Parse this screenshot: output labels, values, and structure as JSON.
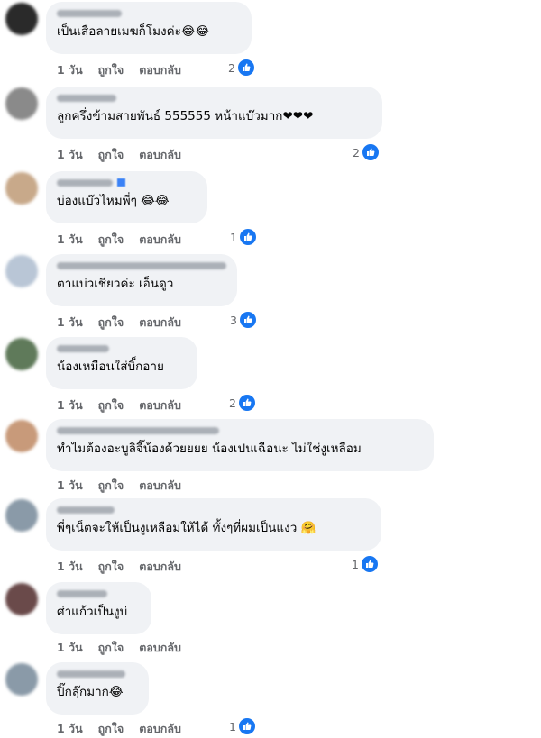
{
  "actions": {
    "time": "1 วัน",
    "like": "ถูกใจ",
    "reply": "ตอบกลับ"
  },
  "comments": [
    {
      "text": "เป็นเสือลายเมฆก็โมงค่ะ😂😂",
      "reactions": "2",
      "avatar_color": "#2a2a2a"
    },
    {
      "text": "ลูกครึ่งข้ามสายพันธ์ 555555 หน้าแบ๊วมาก❤❤❤",
      "reactions": "2",
      "avatar_color": "#8a8a8a"
    },
    {
      "text": "บ่องแบ๊วไหมพี่ๆ 😂😂",
      "reactions": "1",
      "avatar_color": "#c8a98a"
    },
    {
      "text": "ตาแบ่วเชียวค่ะ เอ็นดูว",
      "reactions": "3",
      "avatar_color": "#b9c6d6"
    },
    {
      "text": "น้องเหมือนใส่บิ็กอาย",
      "reactions": "2",
      "avatar_color": "#5f7a5a"
    },
    {
      "text": "ทำไมต้องอะบูลิจี๊น้องด้วยยยย น้องเปนเฉือนะ ไม่ใช่งูเหลือม",
      "reactions": "",
      "avatar_color": "#c89a7a"
    },
    {
      "text": "พี่ๆเน็ตจะให้เป็นงูเหลือมให้ได้ ทั้งๆที่ผมเป็นแงว 🤗",
      "reactions": "1",
      "avatar_color": "#8a9aa8"
    },
    {
      "text": "ศ่าแก้วเป็นงูบ่",
      "reactions": "",
      "avatar_color": "#6a4a4a"
    },
    {
      "text": "ปิ๊กลุ๊กมาก😂",
      "reactions": "1",
      "avatar_color": "#8a9aa8"
    }
  ]
}
